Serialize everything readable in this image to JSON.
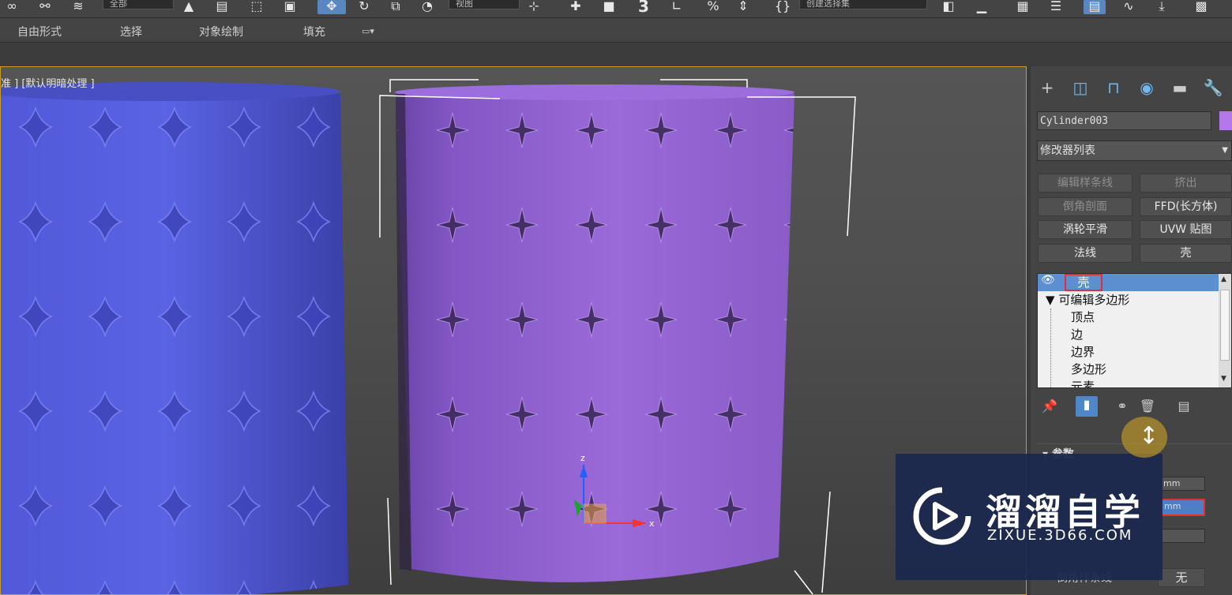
{
  "toolbar": {
    "selection_filter": "全部",
    "coord_system": "视图",
    "selection_set": "创建选择集",
    "snap_value": "3"
  },
  "ribbon": {
    "tabs": [
      "自由形式",
      "选择",
      "对象绘制",
      "填充"
    ]
  },
  "viewport": {
    "label": "准 ] [默认明暗处理 ]",
    "axis_x": "x",
    "axis_z": "z"
  },
  "panel": {
    "object_name": "Cylinder003",
    "object_color": "#b478e8",
    "modifier_list": "修改器列表",
    "modifier_buttons": [
      "编辑样条线",
      "挤出",
      "倒角剖面",
      "FFD(长方体)",
      "涡轮平滑",
      "UVW 贴图",
      "法线",
      "壳"
    ],
    "stack": {
      "selected": "壳",
      "base": "可编辑多边形",
      "sub_objects": [
        "顶点",
        "边",
        "边界",
        "多边形",
        "元素"
      ]
    },
    "params_label": "参数",
    "spinner_unit_1": "mm",
    "spinner_unit_2": "mm",
    "none_button": "无",
    "extra_label": "倒角样条线"
  },
  "watermark": {
    "title": "溜溜自学",
    "subtitle": "ZIXUE.3D66.COM"
  }
}
